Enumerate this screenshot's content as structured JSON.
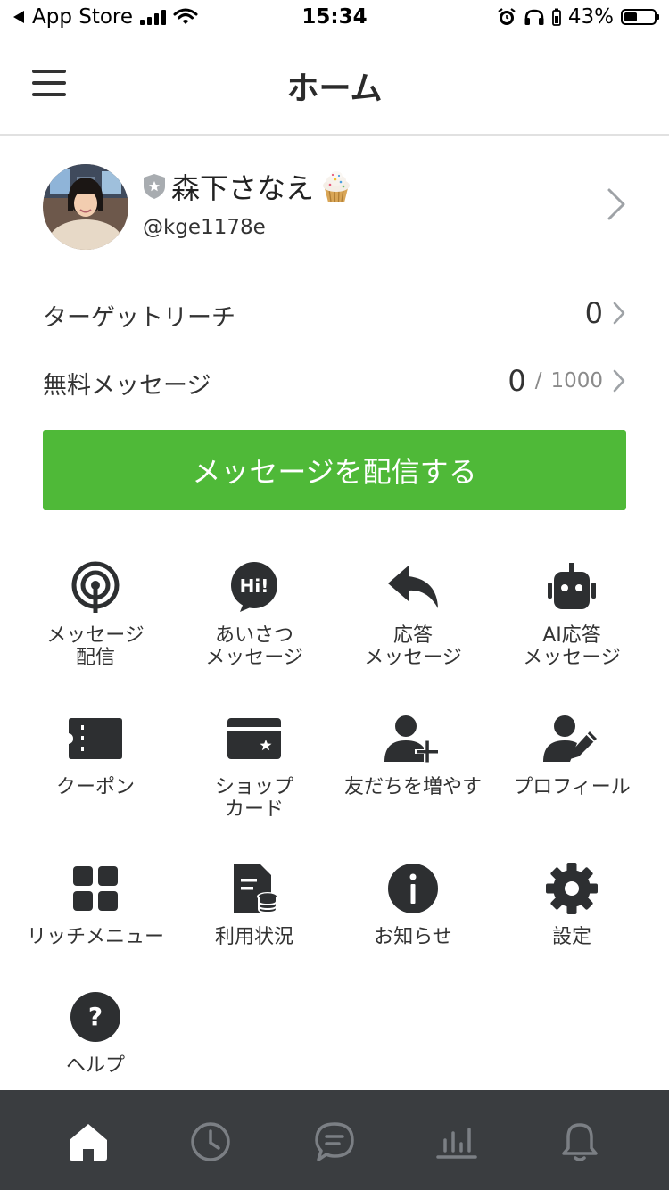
{
  "status_bar": {
    "back_app": "App Store",
    "time": "15:34",
    "battery_percent": "43%",
    "battery_level": 0.43
  },
  "header": {
    "title": "ホーム"
  },
  "profile": {
    "name": "森下さなえ",
    "handle": "@kge1178e"
  },
  "stats": {
    "target_reach": {
      "label": "ターゲットリーチ",
      "value": "0"
    },
    "free_messages": {
      "label": "無料メッセージ",
      "value": "0",
      "separator": "/",
      "limit": "1000"
    }
  },
  "send_button": "メッセージを配信する",
  "menu": [
    {
      "label": "メッセージ\n配信",
      "icon": "broadcast-icon"
    },
    {
      "label": "あいさつ\nメッセージ",
      "icon": "hi-bubble-icon"
    },
    {
      "label": "応答\nメッセージ",
      "icon": "reply-arrow-icon"
    },
    {
      "label": "AI応答\nメッセージ",
      "icon": "robot-icon"
    },
    {
      "label": "クーポン",
      "icon": "coupon-icon"
    },
    {
      "label": "ショップ\nカード",
      "icon": "shop-card-icon"
    },
    {
      "label": "友だちを増やす",
      "icon": "add-friend-icon"
    },
    {
      "label": "プロフィール",
      "icon": "edit-profile-icon"
    },
    {
      "label": "リッチメニュー",
      "icon": "rich-menu-grid-icon"
    },
    {
      "label": "利用状況",
      "icon": "usage-report-icon"
    },
    {
      "label": "お知らせ",
      "icon": "info-icon"
    },
    {
      "label": "設定",
      "icon": "gear-icon"
    },
    {
      "label": "ヘルプ",
      "icon": "help-icon"
    }
  ],
  "tab_bar": [
    {
      "icon": "home-icon",
      "active": true
    },
    {
      "icon": "clock-icon",
      "active": false
    },
    {
      "icon": "chat-icon",
      "active": false
    },
    {
      "icon": "analytics-chart-icon",
      "active": false
    },
    {
      "icon": "bell-icon",
      "active": false
    }
  ],
  "colors": {
    "accent_green": "#4fb938",
    "icon_dark": "#2d2f31",
    "tab_bar_bg": "#3a3d40",
    "tab_inactive": "#7b7f84"
  }
}
